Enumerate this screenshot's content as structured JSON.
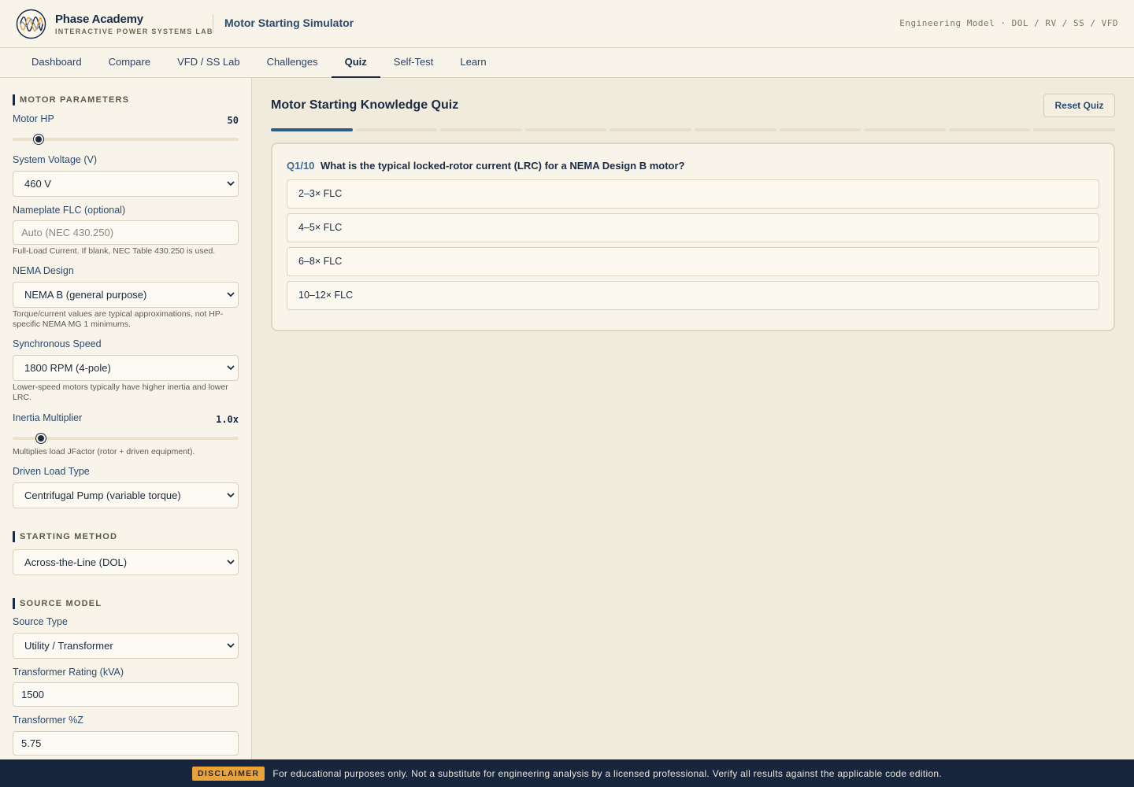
{
  "brand": {
    "name": "Phase Academy",
    "subtitle": "INTERACTIVE POWER SYSTEMS LAB",
    "app_title": "Motor Starting Simulator",
    "model_info": "Engineering Model · DOL / RV / SS / VFD"
  },
  "nav": {
    "tabs": [
      {
        "label": "Dashboard",
        "active": false
      },
      {
        "label": "Compare",
        "active": false
      },
      {
        "label": "VFD / SS Lab",
        "active": false
      },
      {
        "label": "Challenges",
        "active": false
      },
      {
        "label": "Quiz",
        "active": true
      },
      {
        "label": "Self-Test",
        "active": false
      },
      {
        "label": "Learn",
        "active": false
      }
    ]
  },
  "sidebar": {
    "motor_parameters": {
      "title": "MOTOR PARAMETERS",
      "motor_hp": {
        "label": "Motor HP",
        "value": "50",
        "fraction": 0.122
      },
      "system_voltage": {
        "label": "System Voltage (V)",
        "value": "460 V"
      },
      "nameplate_flc": {
        "label": "Nameplate FLC (optional)",
        "placeholder": "Auto (NEC 430.250)",
        "hint": "Full-Load Current. If blank, NEC Table 430.250 is used."
      },
      "nema_design": {
        "label": "NEMA Design",
        "value": "NEMA B (general purpose)",
        "hint": "Torque/current values are typical approximations, not HP-specific NEMA MG 1 minimums."
      },
      "sync_speed": {
        "label": "Synchronous Speed",
        "value": "1800 RPM (4-pole)",
        "hint": "Lower-speed motors typically have higher inertia and lower LRC."
      },
      "inertia": {
        "label": "Inertia Multiplier",
        "value": "1.0x",
        "fraction": 0.132,
        "hint": "Multiplies load JFactor (rotor + driven equipment)."
      },
      "driven_load": {
        "label": "Driven Load Type",
        "value": "Centrifugal Pump (variable torque)"
      }
    },
    "starting_method": {
      "title": "STARTING METHOD",
      "value": "Across-the-Line (DOL)"
    },
    "source_model": {
      "title": "SOURCE MODEL",
      "source_type": {
        "label": "Source Type",
        "value": "Utility / Transformer"
      },
      "transformer_kva": {
        "label": "Transformer Rating (kVA)",
        "value": "1500"
      },
      "transformer_z": {
        "label": "Transformer %Z",
        "value": "5.75"
      }
    }
  },
  "quiz": {
    "title": "Motor Starting Knowledge Quiz",
    "reset_label": "Reset Quiz",
    "progress": {
      "current": 1,
      "total": 10
    },
    "question_number": "Q1/10",
    "question_text": "What is the typical locked-rotor current (LRC) for a NEMA Design B motor?",
    "options": [
      "2–3× FLC",
      "4–5× FLC",
      "6–8× FLC",
      "10–12× FLC"
    ]
  },
  "disclaimer": {
    "badge": "DISCLAIMER",
    "text": "For educational purposes only. Not a substitute for engineering analysis by a licensed professional. Verify all results against the applicable code edition."
  },
  "colors": {
    "primary": "#1b2b44",
    "accent": "#2e5a85",
    "warning": "#e8a33a",
    "background": "#f1ebdd"
  }
}
